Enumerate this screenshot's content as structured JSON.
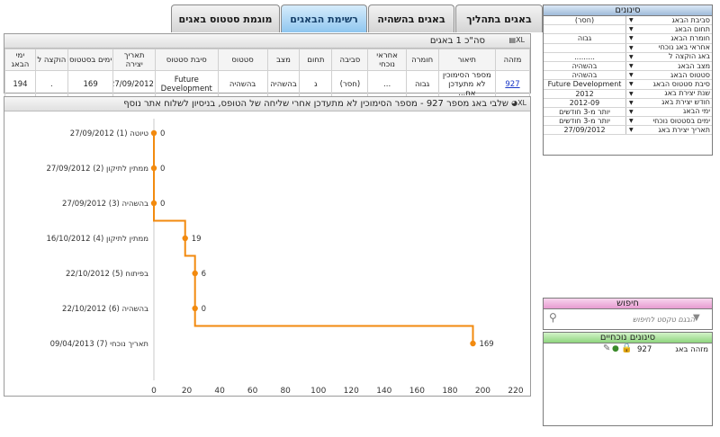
{
  "tabs": [
    {
      "label": "באגים בתהליך"
    },
    {
      "label": "באגים בהשהיה"
    },
    {
      "label": "רשימת הבאגים"
    },
    {
      "label": "מוגמת סטטוס באגים"
    }
  ],
  "bugs_panel": {
    "title": "סה\"כ 1 באגים",
    "excel_label": "XL",
    "columns": [
      "מזהה",
      "תיאור",
      "חומרה",
      "אחראי נוכחי",
      "סביבה",
      "תחום",
      "מצב",
      "סטטוס",
      "סיבת סטטוס",
      "תאריך יצירה",
      "ימים בסטטוס",
      "הוקצה ל",
      "ימי הבאג"
    ],
    "row": {
      "id": "927",
      "description": "מספר הסימוכין לא מתעדכן אח...",
      "severity": "גבוה",
      "assignee": "...",
      "environment": "(חסר)",
      "domain": "ג",
      "state": "בהשהיה",
      "status": "בהשהיה",
      "status_reason": "Future Development",
      "created": "27/09/2012",
      "days_in_status": "169",
      "assigned_to": ".",
      "bug_days": "194"
    }
  },
  "chart_panel": {
    "title": "שלבי באג מספר 927 - מספר הסימוכין לא מתעדכן אחרי שליחה של הטופס, בניסיון לשלוח אתר נוסף",
    "excel_label": "XL"
  },
  "chart_data": {
    "type": "line",
    "title": "",
    "xlabel": "",
    "ylabel": "",
    "xlim": [
      0,
      220
    ],
    "xticks": [
      0,
      20,
      40,
      60,
      80,
      100,
      120,
      140,
      160,
      180,
      200,
      220
    ],
    "line_color": "#f28a0f",
    "categories": [
      "27/09/2012 טיוטה (1)",
      "27/09/2012 ממתין לתיקון (2)",
      "27/09/2012 בהשהיה (3)",
      "16/10/2012 ממתין לתיקון (4)",
      "22/10/2012 בפיתוח (5)",
      "22/10/2012 בהשהיה (6)",
      "09/04/2013 תאריך נוכחי (7)"
    ],
    "x": [
      0,
      0,
      0,
      19,
      25,
      25,
      194
    ],
    "labels": [
      "0",
      "0",
      "0",
      "19",
      "6",
      "0",
      "169"
    ]
  },
  "filters": {
    "title": "סינונים",
    "rows": [
      {
        "label": "סביבת הבאג",
        "value": "(חסר)"
      },
      {
        "label": "תחום הבאג",
        "value": ""
      },
      {
        "label": "חומרת הבאג",
        "value": "גבוה"
      },
      {
        "label": "אחראי באג נוכחי",
        "value": ""
      },
      {
        "label": "באג הוקצה ל",
        "value": "........."
      },
      {
        "label": "מצב הבאג",
        "value": "בהשהיה"
      },
      {
        "label": "סטטוס הבאג",
        "value": "בהשהיה"
      },
      {
        "label": "סיבת סטטוס הבאג",
        "value": "Future Development"
      },
      {
        "label": "שנת יצירת באג",
        "value": "2012"
      },
      {
        "label": "חודש יצירת באג",
        "value": "2012-09"
      },
      {
        "label": "ימי הבאג",
        "value": "יותר מ-3 חודשים"
      },
      {
        "label": "ימים בסטטוס נוכחי",
        "value": "יותר מ-3 חודשים"
      },
      {
        "label": "תאריך יצירת באג",
        "value": "27/09/2012"
      }
    ]
  },
  "search": {
    "title": "חיפוש",
    "placeholder": "הבגם טקסט לחיפוש"
  },
  "current_filters": {
    "title": "סינונים נוכחיים",
    "items": [
      {
        "label": "מזהה באג",
        "value": "927"
      }
    ]
  }
}
